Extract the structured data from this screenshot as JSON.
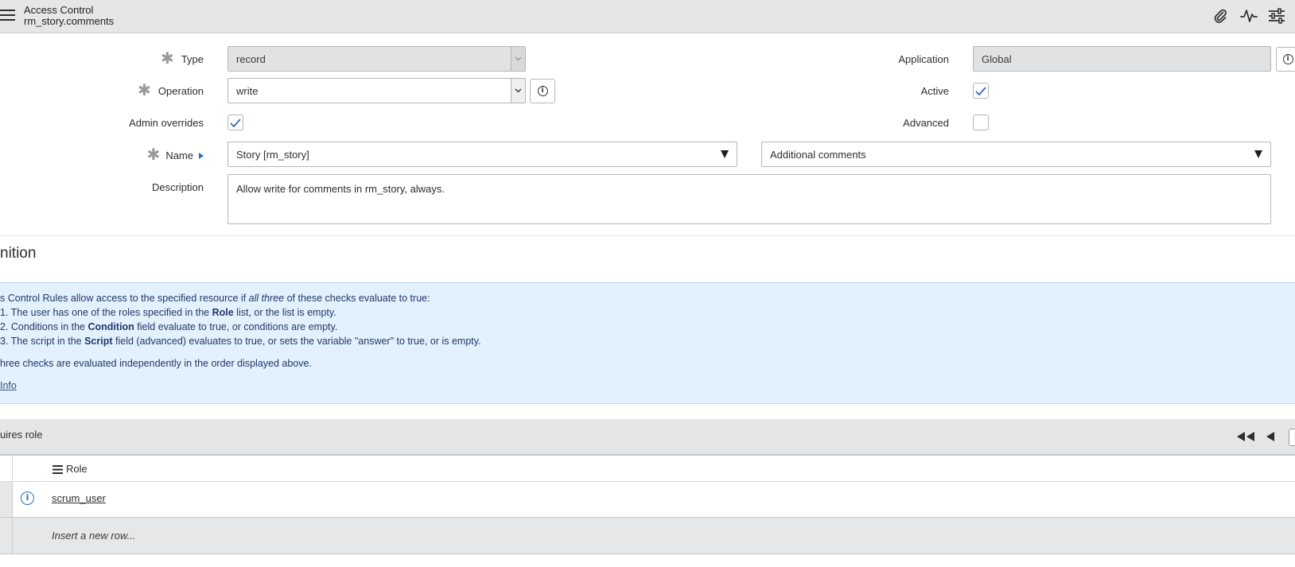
{
  "header": {
    "title": "Access Control",
    "subtitle": "rm_story.comments",
    "icons": [
      "menu-icon",
      "paperclip-icon",
      "activity-icon",
      "settings-sliders-icon"
    ]
  },
  "form": {
    "type_label": "Type",
    "type_value": "record",
    "operation_label": "Operation",
    "operation_value": "write",
    "admin_overrides_label": "Admin overrides",
    "admin_overrides_checked": true,
    "name_label": "Name",
    "name_table_value": "Story [rm_story]",
    "name_field_value": "Additional comments",
    "description_label": "Description",
    "description_value": "Allow write for comments in rm_story, always.",
    "application_label": "Application",
    "application_value": "Global",
    "active_label": "Active",
    "active_checked": true,
    "advanced_label": "Advanced",
    "advanced_checked": false
  },
  "definition": {
    "section_title": "nition",
    "intro_pre": "s Control Rules allow access to the specified resource if ",
    "intro_em": "all three",
    "intro_post": " of these checks evaluate to true:",
    "item1_pre": "1. The user has one of the roles specified in the ",
    "item1_bold": "Role",
    "item1_post": " list, or the list is empty.",
    "item2_pre": "2. Conditions in the ",
    "item2_bold": "Condition",
    "item2_post": " field evaluate to true, or conditions are empty.",
    "item3_pre": "3. The script in the ",
    "item3_bold": "Script",
    "item3_post": " field (advanced) evaluates to true, or sets the variable \"answer\" to true, or is empty.",
    "note": "hree checks are evaluated independently in the order displayed above.",
    "more_info": "Info"
  },
  "related_list": {
    "title": "uires role",
    "column_header": "Role",
    "rows": [
      {
        "role": "scrum_user"
      }
    ],
    "insert_row": "Insert a new row..."
  },
  "colors": {
    "header_bg": "#e4e6e7",
    "info_bg": "#e2f1fc",
    "info_text": "#22386b",
    "check_blue": "#2e6bbd"
  }
}
